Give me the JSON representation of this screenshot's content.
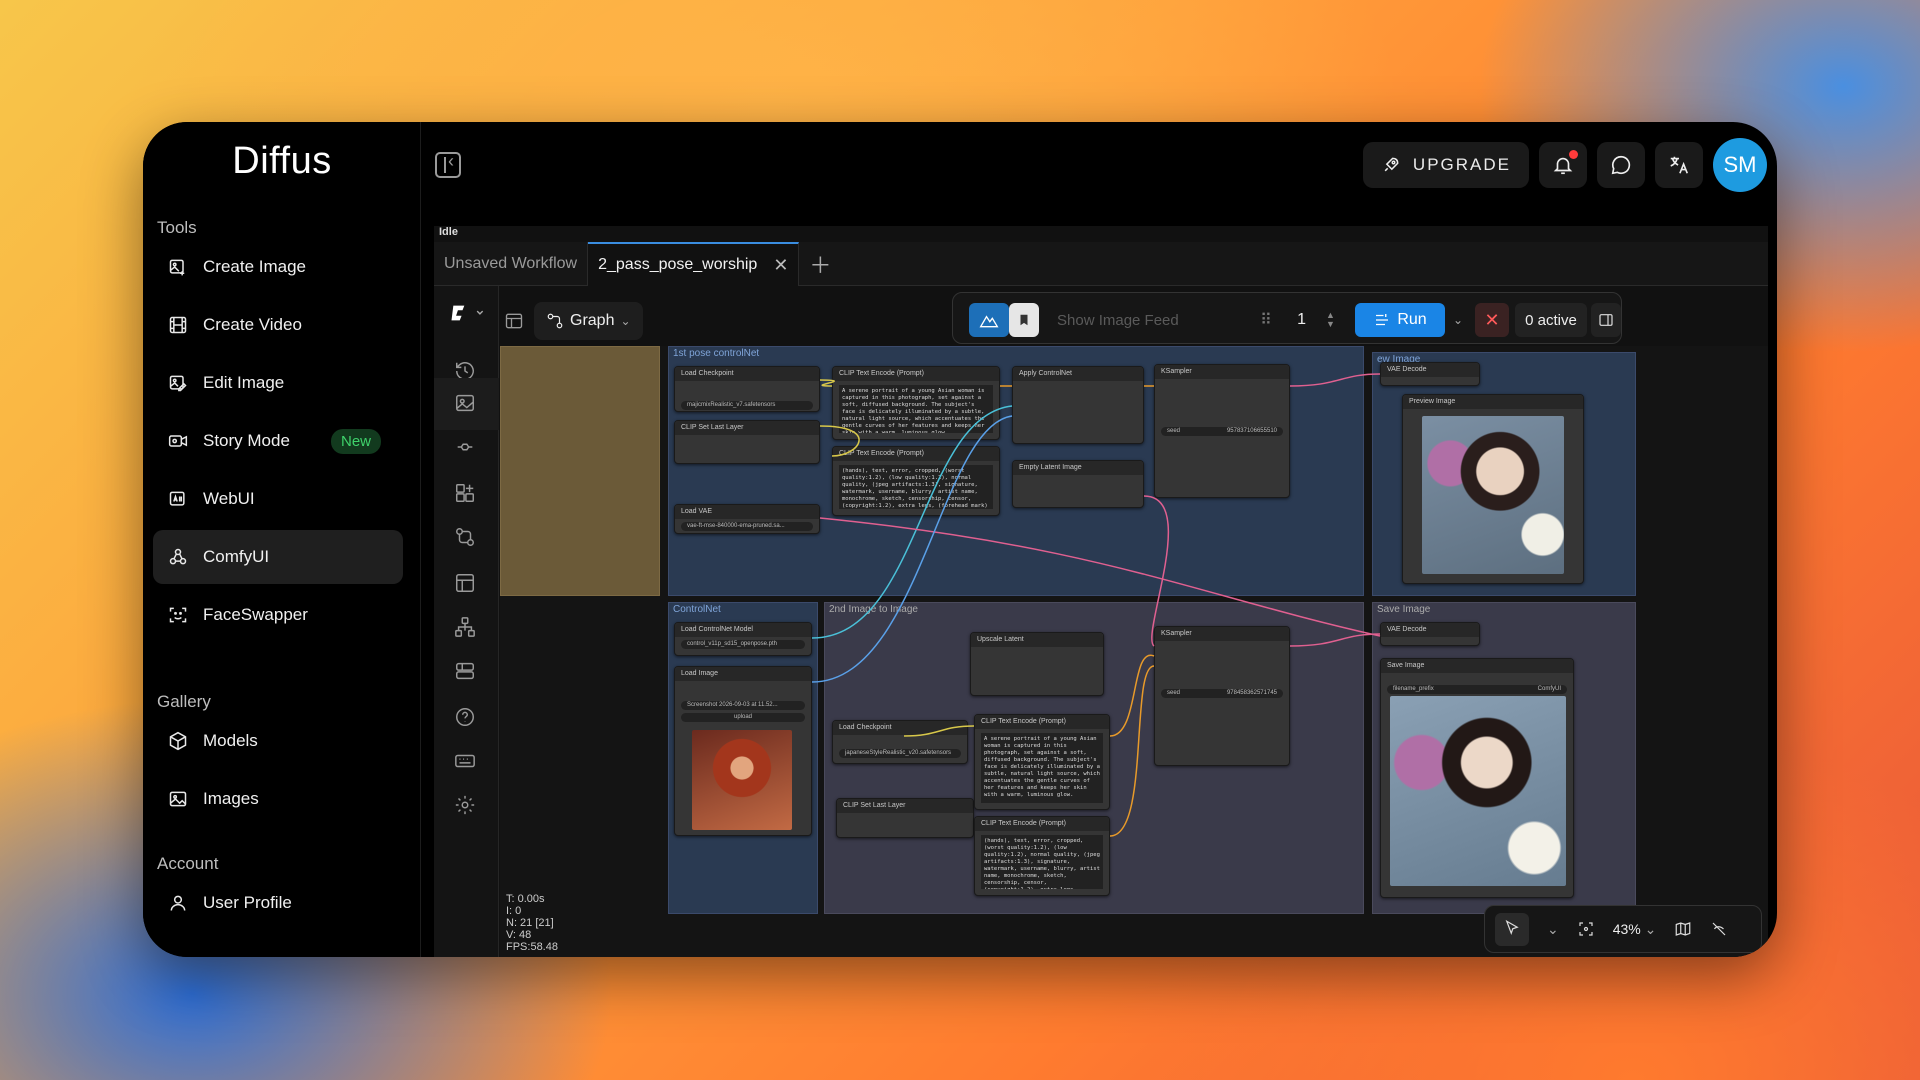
{
  "brand": "Diffus",
  "sections": {
    "tools": "Tools",
    "gallery": "Gallery",
    "account": "Account"
  },
  "nav": [
    {
      "label": "Create Image",
      "icon": "image-plus-icon"
    },
    {
      "label": "Create Video",
      "icon": "film-icon"
    },
    {
      "label": "Edit Image",
      "icon": "image-edit-icon"
    },
    {
      "label": "Story Mode",
      "icon": "video-icon",
      "badge": "New"
    },
    {
      "label": "WebUI",
      "icon": "webui-icon"
    },
    {
      "label": "ComfyUI",
      "icon": "nodes-icon",
      "active": true
    },
    {
      "label": "FaceSwapper",
      "icon": "face-scan-icon"
    },
    {
      "label": "Models",
      "icon": "cube-icon"
    },
    {
      "label": "Images",
      "icon": "image-icon"
    },
    {
      "label": "User Profile",
      "icon": "user-icon"
    }
  ],
  "header": {
    "upgrade": "UPGRADE",
    "avatar": "SM"
  },
  "status": "Idle",
  "tabs": [
    "Unsaved Workflow",
    "2_pass_pose_worship"
  ],
  "toolbar": {
    "view_mode": "Graph",
    "show_feed": "Show Image Feed",
    "queue_count": "1",
    "run": "Run",
    "active": "0 active",
    "zoom": "43%"
  },
  "stats": {
    "t": "T: 0.00s",
    "i": "I: 0",
    "n": "N: 21 [21]",
    "v": "V: 48",
    "fps": "FPS:58.48"
  },
  "groups": {
    "g1": "1st pose controlNet",
    "g2": "ControlNet",
    "g3": "2nd Image to Image",
    "g4": "Save Image",
    "g5": "ew Image"
  },
  "nodes": {
    "load_ckpt": "Load Checkpoint",
    "ckpt_val": "majicmixRealistic_v7.safetensors",
    "clip_last": "CLIP Set Last Layer",
    "clip_text1": "CLIP Text Encode (Prompt)",
    "clip_text2": "CLIP Text Encode (Prompt)",
    "apply_cn": "Apply ControlNet",
    "ksampler": "KSampler",
    "vae_decode": "VAE Decode",
    "preview": "Preview Image",
    "load_vae": "Load VAE",
    "vae_val": "vae-ft-mse-840000-ema-pruned.sa...",
    "empty_latent": "Empty Latent Image",
    "load_cn": "Load ControlNet Model",
    "cn_val": "control_v11p_sd15_openpose.pth",
    "load_image": "Load Image",
    "image_val": "Screenshot 2026-09-03 at 11.52...",
    "upload": "upload",
    "upscale": "Upscale Latent",
    "load_ckpt2": "Load Checkpoint",
    "ckpt2_val": "japaneseStyleRealistic_v20.safetensors",
    "clip_last2": "CLIP Set Last Layer",
    "clip_text3": "CLIP Text Encode (Prompt)",
    "clip_text4": "CLIP Text Encode (Prompt)",
    "ksampler2": "KSampler",
    "vae_decode2": "VAE Decode",
    "save_image": "Save Image",
    "prefix": "filename_prefix",
    "prefix_val": "ComfyUI",
    "pos_prompt": "A serene portrait of a young Asian woman is captured in this photograph, set against a soft, diffused background. The subject's face is delicately illuminated by a subtle, natural light source, which accentuates the gentle curves of her features and keeps her skin with a warm, luminous glow.",
    "neg_prompt": "(hands), text, error, cropped, (worst quality:1.2), (low quality:1.2), normal quality, (jpeg artifacts:1.3), signature, watermark, username, blurry, artist name, monochrome, sketch, censorship, censor, (copyright:1.2), extra legs, (forehead mark) (depth of field) (emotionless) (penis) (pumpkin)",
    "seed1": "957837106655510",
    "seed2": "978458362571745"
  }
}
